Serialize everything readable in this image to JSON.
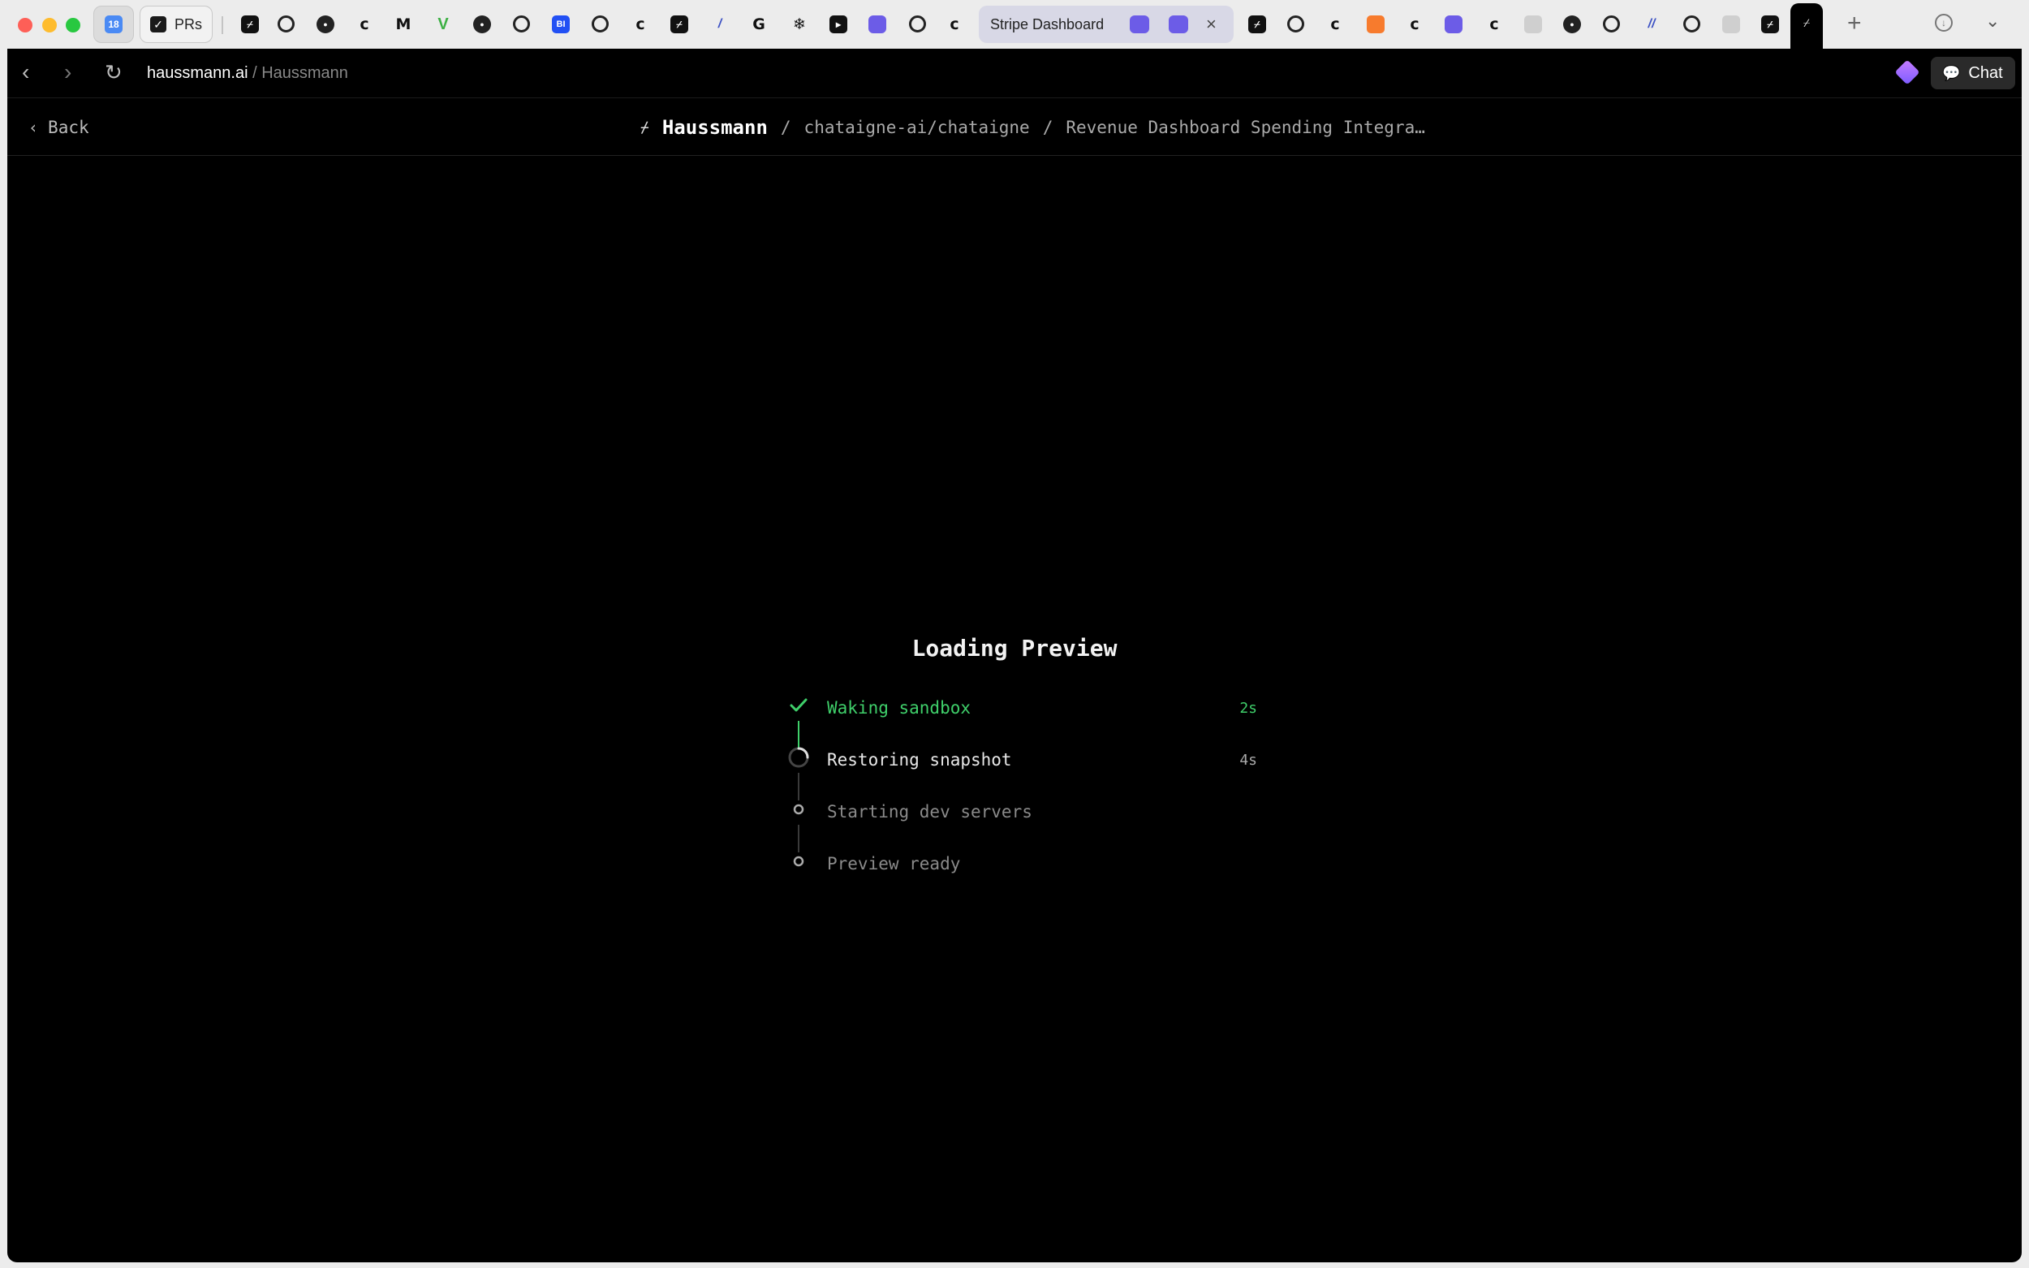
{
  "browser": {
    "pinned_tabs": [
      {
        "icon": "calendar-icon",
        "label": "18"
      },
      {
        "icon": "checkbox-icon",
        "label": "PRs"
      }
    ],
    "stripe_tab": {
      "label": "Stripe Dashboard"
    },
    "tab_icons": [
      "haussmann-icon",
      "github-icon",
      "circle-logo-icon",
      "c-letter-icon",
      "gmail-icon",
      "vue-icon",
      "circle-logo-icon",
      "triangle-logo-icon",
      "bi-logo-icon",
      "github-x-icon",
      "c-letter-icon",
      "haussmann-icon",
      "stripes-logo-icon",
      "google-icon",
      "snowflake-icon",
      "cursor-icon",
      "linear-icon",
      "openai-icon",
      "c-letter-icon",
      "haussmann-icon",
      "github-icon",
      "c-letter-icon",
      "orange-app-icon",
      "c-letter-icon",
      "linear-icon",
      "c-letter-icon",
      "gray-tab-icon",
      "circle-logo-icon",
      "github-icon",
      "slash-logo-icon",
      "github-icon",
      "gray-tab-icon",
      "haussmann-icon"
    ],
    "url_domain": "haussmann.ai",
    "url_title": "/ Haussmann",
    "chat_label": "Chat"
  },
  "header": {
    "back_label": "Back",
    "brand": "Haussmann",
    "repo": "chataigne-ai/chataigne",
    "task": "Revenue Dashboard Spending Integra…"
  },
  "loader": {
    "title": "Loading Preview",
    "steps": [
      {
        "label": "Waking sandbox",
        "time": "2s",
        "state": "done"
      },
      {
        "label": "Restoring snapshot",
        "time": "4s",
        "state": "active"
      },
      {
        "label": "Starting dev servers",
        "time": "",
        "state": "pending"
      },
      {
        "label": "Preview ready",
        "time": "",
        "state": "pending"
      }
    ]
  },
  "colors": {
    "done": "#3fcf6a",
    "active": "#e8e8e8",
    "pending": "#8a8a8a",
    "background": "#000000"
  }
}
